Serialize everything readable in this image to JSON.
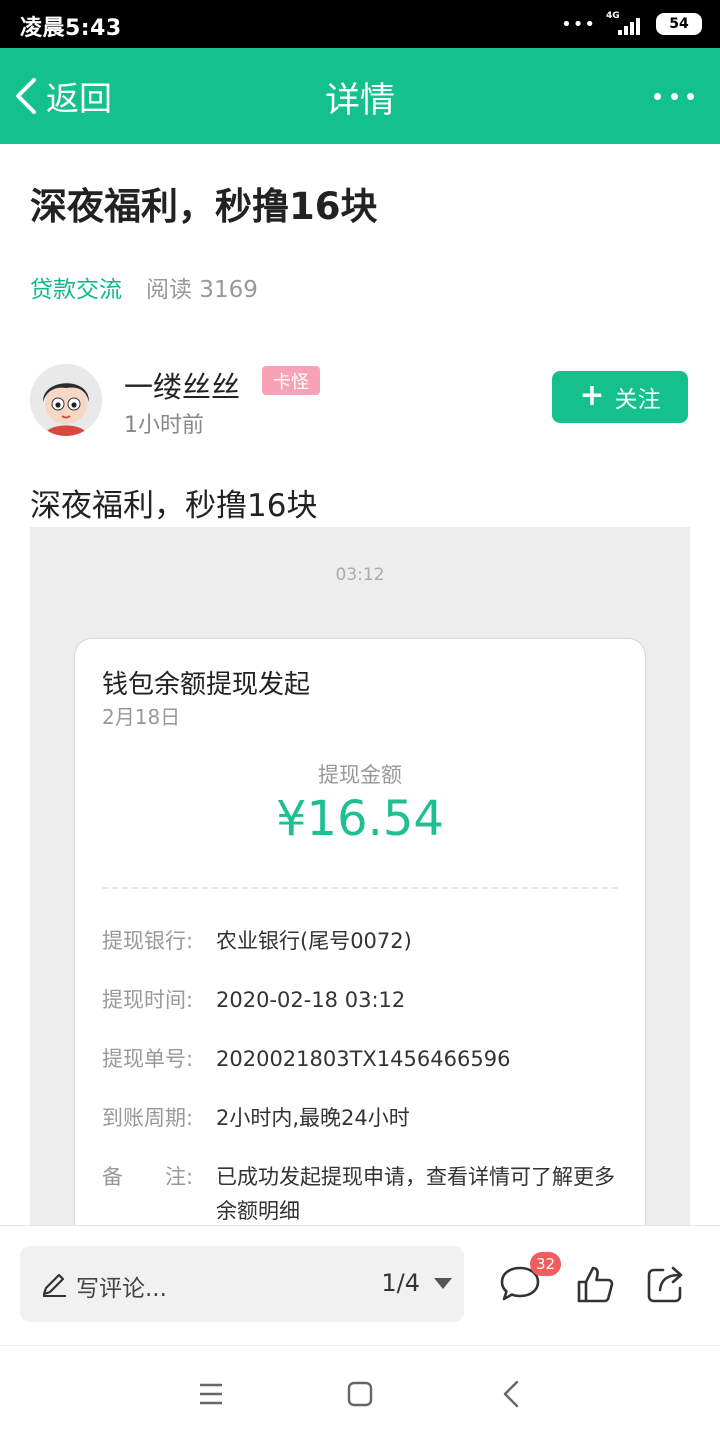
{
  "status_bar": {
    "time": "凌晨5:43",
    "dots": "•••",
    "network": "4G",
    "battery": "54"
  },
  "header": {
    "back_label": "返回",
    "title": "详情"
  },
  "article": {
    "title": "深夜福利，秒撸16块",
    "category": "贷款交流",
    "reads": "阅读 3169",
    "author": {
      "name": "一缕丝丝",
      "badge": "卡怪",
      "time": "1小时前"
    },
    "follow_label": "关注",
    "body_text": "深夜福利，秒撸16块"
  },
  "screenshot": {
    "time": "03:12",
    "card_title": "钱包余额提现发起",
    "card_date": "2月18日",
    "amount_label": "提现金额",
    "amount": "¥16.54",
    "rows": [
      {
        "label": "提现银行:",
        "value": "农业银行(尾号0072)"
      },
      {
        "label": "提现时间:",
        "value": "2020-02-18 03:12"
      },
      {
        "label": "提现单号:",
        "value": "2020021803TX1456466596"
      },
      {
        "label": "到账周期:",
        "value": "2小时内,最晚24小时"
      },
      {
        "label": "备　　注:",
        "value": "已成功发起提现申请，查看详情可了解更多余额明细"
      }
    ]
  },
  "bottom_bar": {
    "comment_placeholder": "写评论...",
    "page_indicator": "1/4",
    "comment_count": "32"
  },
  "colors": {
    "accent": "#14c08c",
    "badge_pink": "#f7a3b5",
    "amount_green": "#1fbf91",
    "count_red": "#f25c5c"
  }
}
